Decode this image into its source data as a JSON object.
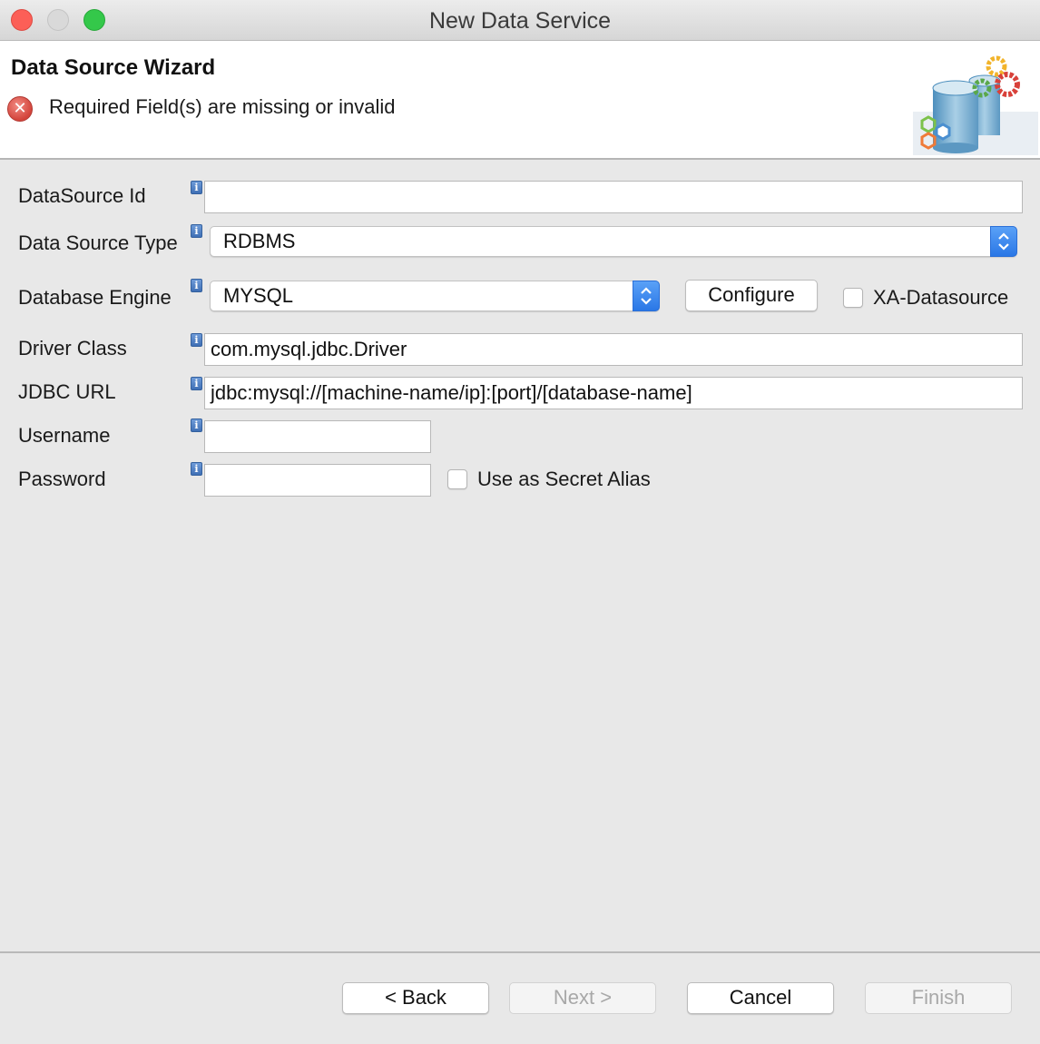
{
  "window": {
    "title": "New Data Service"
  },
  "banner": {
    "title": "Data Source Wizard",
    "message": "Required Field(s) are missing or invalid"
  },
  "form": {
    "datasource_id": {
      "label": "DataSource Id",
      "value": ""
    },
    "datasource_type": {
      "label": "Data Source Type",
      "value": "RDBMS"
    },
    "database_engine": {
      "label": "Database Engine",
      "value": "MYSQL"
    },
    "configure_label": "Configure",
    "xa_label": "XA-Datasource",
    "driver_class": {
      "label": "Driver Class",
      "value": "com.mysql.jdbc.Driver"
    },
    "jdbc_url": {
      "label": "JDBC URL",
      "value": "jdbc:mysql://[machine-name/ip]:[port]/[database-name]"
    },
    "username": {
      "label": "Username",
      "value": ""
    },
    "password": {
      "label": "Password",
      "value": ""
    },
    "secret_alias_label": "Use as Secret Alias"
  },
  "buttons": {
    "back": "< Back",
    "next": "Next >",
    "cancel": "Cancel",
    "finish": "Finish"
  },
  "icons": {
    "info": "info-icon",
    "error": "error-icon",
    "wizard": "datasource-wizard-icon"
  },
  "colors": {
    "error": "#d3443b",
    "accent": "#2a77e6",
    "info": "#3f6fb5"
  }
}
